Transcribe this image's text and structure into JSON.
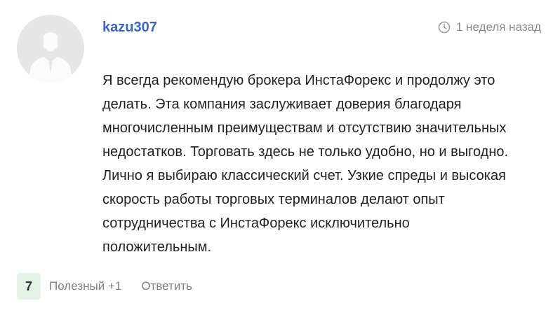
{
  "comment": {
    "author": "kazu307",
    "timestamp": "1 неделя назад",
    "body_lines": [
      "Я всегда рекомендую брокера ИнстаФорекс и продолжу это",
      "делать. Эта компания заслуживает доверия благодаря",
      "многочисленным преимуществам и отсутствию значительных",
      "недостатков. Торговать здесь не только удобно, но и выгодно.",
      "Лично я выбираю классический счет. Узкие спреды и высокая",
      "скорость работы торговых терминалов делают опыт",
      "сотрудничества с ИнстаФорекс исключительно",
      "положительным."
    ]
  },
  "actions": {
    "score": "7",
    "useful_label": "Полезный +1",
    "reply_label": "Ответить"
  },
  "icons": {
    "avatar": "user-silhouette-icon",
    "timestamp": "clock-icon"
  },
  "colors": {
    "author": "#3b63c9",
    "score_bg": "#e4f3e6",
    "muted_text": "#808080"
  }
}
